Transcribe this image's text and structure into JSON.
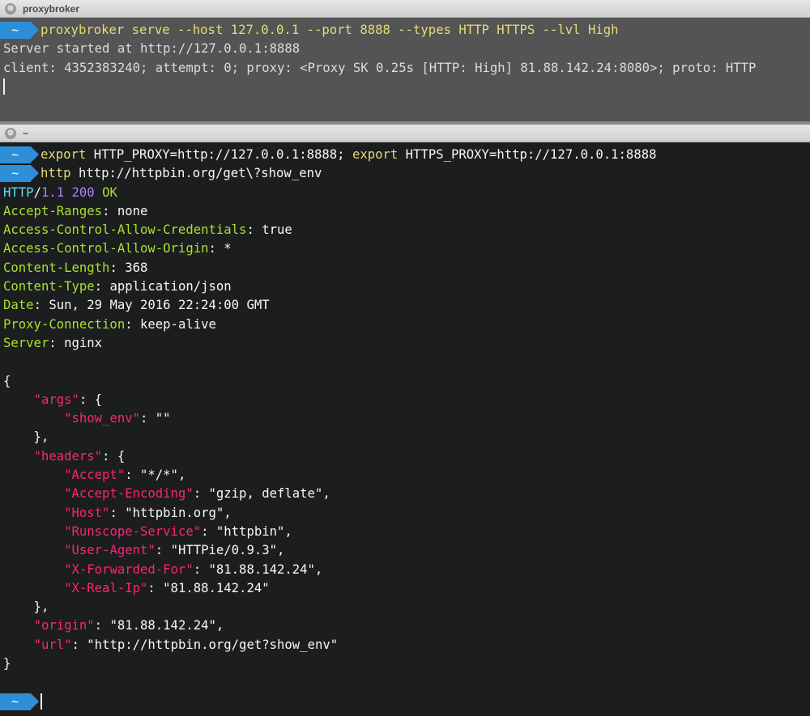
{
  "top_pane": {
    "title": "proxybroker",
    "close_glyph": "⊗",
    "prompt_badge": "~",
    "cmd_name": "proxybroker",
    "cmd_args": " serve --host 127.0.0.1 --port 8888 --types HTTP HTTPS --lvl High",
    "server_started": "Server started at http://127.0.0.1:8888",
    "client_log": "client: 4352383240; attempt: 0; proxy: <Proxy SK 0.25s [HTTP: High] 81.88.142.24:8080>; proto: HTTP"
  },
  "bottom_pane": {
    "title": "~",
    "close_glyph": "⊗",
    "prompt_badge": "~",
    "cmd1": {
      "kw1": "export",
      "arg1": " HTTP_PROXY=http://127.0.0.1:8888; ",
      "kw2": "export",
      "arg2": " HTTPS_PROXY=http://127.0.0.1:8888"
    },
    "cmd2": {
      "name": "http",
      "arg": " http://httpbin.org/get\\?show_env"
    },
    "status": {
      "proto": "HTTP",
      "slash": "/",
      "version": "1.1",
      "code": "200",
      "text": "OK"
    },
    "headers": [
      {
        "key": "Accept-Ranges",
        "value": "none"
      },
      {
        "key": "Access-Control-Allow-Credentials",
        "value": "true"
      },
      {
        "key": "Access-Control-Allow-Origin",
        "value": "*"
      },
      {
        "key": "Content-Length",
        "value": "368"
      },
      {
        "key": "Content-Type",
        "value": "application/json"
      },
      {
        "key": "Date",
        "value": "Sun, 29 May 2016 22:24:00 GMT"
      },
      {
        "key": "Proxy-Connection",
        "value": "keep-alive"
      },
      {
        "key": "Server",
        "value": "nginx"
      }
    ],
    "json_body": {
      "args_key": "\"args\"",
      "show_env_key": "\"show_env\"",
      "show_env_val": "\"\"",
      "headers_key": "\"headers\"",
      "headers": [
        {
          "key": "\"Accept\"",
          "value": "\"*/*\","
        },
        {
          "key": "\"Accept-Encoding\"",
          "value": "\"gzip, deflate\","
        },
        {
          "key": "\"Host\"",
          "value": "\"httpbin.org\","
        },
        {
          "key": "\"Runscope-Service\"",
          "value": "\"httpbin\","
        },
        {
          "key": "\"User-Agent\"",
          "value": "\"HTTPie/0.9.3\","
        },
        {
          "key": "\"X-Forwarded-For\"",
          "value": "\"81.88.142.24\","
        },
        {
          "key": "\"X-Real-Ip\"",
          "value": "\"81.88.142.24\""
        }
      ],
      "origin_key": "\"origin\"",
      "origin_val": "\"81.88.142.24\",",
      "url_key": "\"url\"",
      "url_val": "\"http://httpbin.org/get?show_env\""
    }
  },
  "colors": {
    "prompt_badge": "#2e8fd8",
    "command": "#e6db74",
    "header_key": "#a6e22e",
    "json_key": "#f92672",
    "http_proto": "#66d9ef",
    "number": "#ae81ff"
  }
}
